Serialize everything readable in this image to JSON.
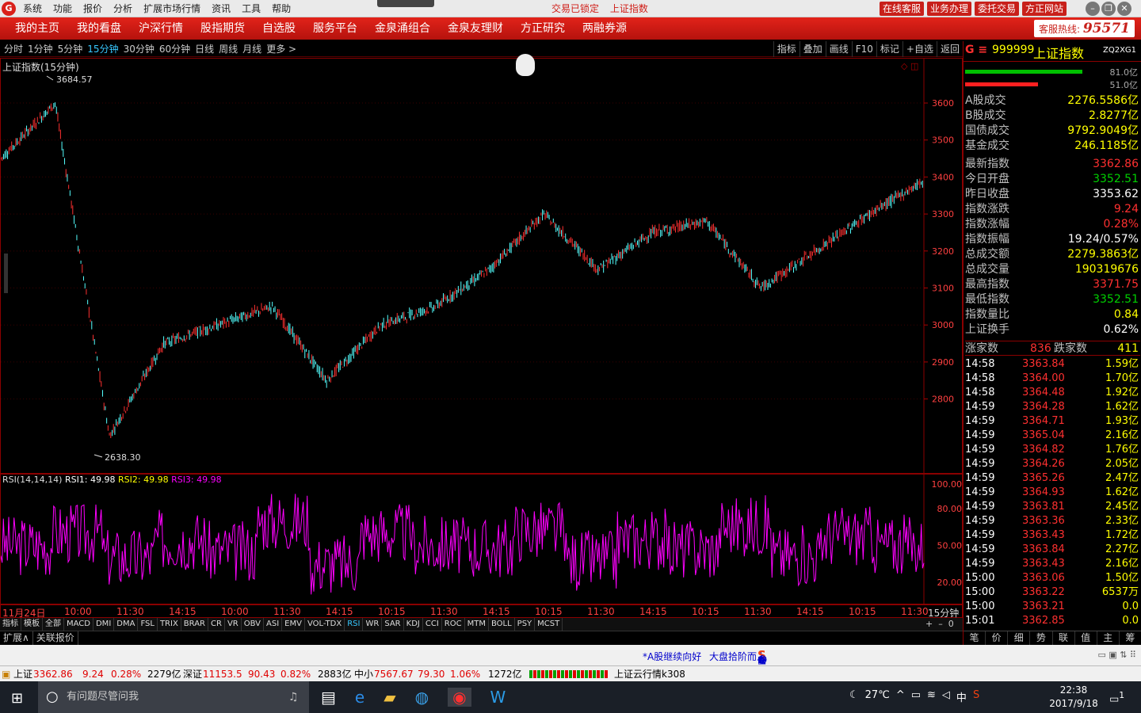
{
  "titlebar": {
    "menus": [
      "系统",
      "功能",
      "报价",
      "分析",
      "扩展市场行情",
      "资讯",
      "工具",
      "帮助"
    ],
    "status_locked": "交易已锁定",
    "current": "上证指数",
    "buttons": [
      "在线客服",
      "业务办理",
      "委托交易",
      "方正网站"
    ]
  },
  "navbar": {
    "items": [
      "我的主页",
      "我的看盘",
      "沪深行情",
      "股指期货",
      "自选股",
      "服务平台",
      "金泉涌组合",
      "金泉友理财",
      "方正研究",
      "两融券源"
    ],
    "hotline_label": "客服热线:",
    "hotline_number": "95571"
  },
  "periods": {
    "items": [
      "分时",
      "1分钟",
      "5分钟",
      "15分钟",
      "30分钟",
      "60分钟",
      "日线",
      "周线",
      "月线",
      "更多 >"
    ],
    "active": 3,
    "chart_buttons": [
      "指标",
      "叠加",
      "画线",
      "F10",
      "标记",
      "+自选",
      "返回"
    ]
  },
  "main_chart": {
    "title": "上证指数(15分钟)",
    "high_label": "3684.57",
    "low_label": "2638.30",
    "y_ticks": [
      3600,
      3500,
      3400,
      3300,
      3200,
      3100,
      3000,
      2900,
      2800
    ],
    "ylim": [
      2600,
      3720
    ]
  },
  "rsi_chart": {
    "title": "RSI(14,14,14)",
    "rsi1_label": "RSI1: 49.98",
    "rsi2_label": "RSI2: 49.98",
    "rsi3_label": "RSI3: 49.98",
    "y_ticks": [
      "100.00",
      "80.00",
      "50.00",
      "20.00"
    ]
  },
  "chart_data": {
    "type": "line",
    "title": "上证指数(15分钟)",
    "xlabel": "",
    "ylabel": "",
    "ylim": [
      2600,
      3720
    ],
    "series": [],
    "x": [
      "11月24日",
      "10:00",
      "11:30",
      "14:15",
      "10:00",
      "11:30",
      "14:15",
      "10:15",
      "11:30",
      "14:15",
      "10:15",
      "11:30",
      "14:15",
      "10:15",
      "11:30",
      "14:15",
      "10:15",
      "11:30"
    ],
    "y": [
      3450,
      3600,
      2700,
      2950,
      3000,
      3050,
      2850,
      3000,
      3050,
      3150,
      3300,
      3150,
      3250,
      3280,
      3100,
      3200,
      3300,
      3390
    ],
    "indicator_series": [
      {
        "name": "RSI",
        "values": [
          50,
          60,
          40,
          55,
          45,
          70,
          35,
          60,
          50,
          48,
          62,
          38,
          55,
          47,
          66,
          42,
          58,
          50
        ]
      }
    ],
    "annotations": [
      "3684.57",
      "2638.30"
    ]
  },
  "time_axis": {
    "labels": [
      "11月24日",
      "10:00",
      "11:30",
      "14:15",
      "10:00",
      "11:30",
      "14:15",
      "10:15",
      "11:30",
      "14:15",
      "10:15",
      "11:30",
      "14:15",
      "10:15",
      "11:30",
      "14:15",
      "10:15",
      "11:30"
    ],
    "period": "15分钟"
  },
  "indicator_tabs": {
    "items": [
      "指标",
      "模板",
      "全部",
      "MACD",
      "DMI",
      "DMA",
      "FSL",
      "TRIX",
      "BRAR",
      "CR",
      "VR",
      "OBV",
      "ASI",
      "EMV",
      "VOL-TDX",
      "RSI",
      "WR",
      "SAR",
      "KDJ",
      "CCI",
      "ROC",
      "MTM",
      "BOLL",
      "PSY",
      "MCST"
    ],
    "selected": 15
  },
  "bottom_tabs": [
    "扩展∧",
    "关联报价"
  ],
  "right_panel": {
    "code": "999999",
    "name": "上证指数",
    "tag": "ZQ2XG1",
    "bar1": "81.0亿",
    "bar2": "51.0亿",
    "turnover": [
      {
        "label": "A股成交",
        "value": "2276.5586亿"
      },
      {
        "label": "B股成交",
        "value": "2.8277亿"
      },
      {
        "label": "国债成交",
        "value": "9792.9049亿"
      },
      {
        "label": "基金成交",
        "value": "246.1185亿"
      }
    ],
    "stats": [
      {
        "label": "最新指数",
        "value": "3362.86",
        "color": "#ff3030"
      },
      {
        "label": "今日开盘",
        "value": "3352.51",
        "color": "#00d000"
      },
      {
        "label": "昨日收盘",
        "value": "3353.62",
        "color": "#ffffff"
      },
      {
        "label": "指数涨跌",
        "value": "9.24",
        "color": "#ff3030"
      },
      {
        "label": "指数涨幅",
        "value": "0.28%",
        "color": "#ff3030"
      },
      {
        "label": "指数振幅",
        "value": "19.24/0.57%",
        "color": "#ffffff"
      },
      {
        "label": "总成交额",
        "value": "2279.3863亿",
        "color": "#ffff00"
      },
      {
        "label": "总成交量",
        "value": "190319676",
        "color": "#ffff00"
      },
      {
        "label": "最高指数",
        "value": "3371.75",
        "color": "#ff3030"
      },
      {
        "label": "最低指数",
        "value": "3352.51",
        "color": "#00d000"
      },
      {
        "label": "指数量比",
        "value": "0.84",
        "color": "#ffff00"
      },
      {
        "label": "上证换手",
        "value": "0.62%",
        "color": "#ffffff"
      }
    ],
    "up_label": "涨家数",
    "up_count": "836",
    "down_label": "跌家数",
    "down_count": "411",
    "ticks": [
      {
        "t": "14:58",
        "p": "3363.84",
        "q": "1.59亿"
      },
      {
        "t": "14:58",
        "p": "3364.00",
        "q": "1.70亿"
      },
      {
        "t": "14:58",
        "p": "3364.48",
        "q": "1.92亿"
      },
      {
        "t": "14:59",
        "p": "3364.28",
        "q": "1.62亿"
      },
      {
        "t": "14:59",
        "p": "3364.71",
        "q": "1.93亿"
      },
      {
        "t": "14:59",
        "p": "3365.04",
        "q": "2.16亿"
      },
      {
        "t": "14:59",
        "p": "3364.82",
        "q": "1.76亿"
      },
      {
        "t": "14:59",
        "p": "3364.26",
        "q": "2.05亿"
      },
      {
        "t": "14:59",
        "p": "3365.26",
        "q": "2.47亿"
      },
      {
        "t": "14:59",
        "p": "3364.93",
        "q": "1.62亿"
      },
      {
        "t": "14:59",
        "p": "3363.81",
        "q": "2.45亿"
      },
      {
        "t": "14:59",
        "p": "3363.36",
        "q": "2.33亿"
      },
      {
        "t": "14:59",
        "p": "3363.43",
        "q": "1.72亿"
      },
      {
        "t": "14:59",
        "p": "3363.84",
        "q": "2.27亿"
      },
      {
        "t": "14:59",
        "p": "3363.43",
        "q": "2.16亿"
      },
      {
        "t": "15:00",
        "p": "3363.06",
        "q": "1.50亿"
      },
      {
        "t": "15:00",
        "p": "3363.22",
        "q": "6537万"
      },
      {
        "t": "15:00",
        "p": "3363.21",
        "q": "0.0"
      },
      {
        "t": "15:01",
        "p": "3362.85",
        "q": "0.0"
      }
    ],
    "tabs": [
      "笔",
      "价",
      "细",
      "势",
      "联",
      "值",
      "主",
      "筹"
    ]
  },
  "news": {
    "item1": "*A股继续向好",
    "item2": "大盘拾阶而上"
  },
  "status": {
    "sh_label": "上证",
    "sh_value": "3362.86",
    "sh_change": "9.24",
    "sh_pct": "0.28%",
    "sh_amount": "2279亿",
    "sz_label": "深证",
    "sz_value": "11153.5",
    "sz_change": "90.43",
    "sz_pct": "0.82%",
    "sz_amount": "2883亿",
    "zx_label": "中小",
    "zx_value": "7567.67",
    "zx_change": "79.30",
    "zx_pct": "1.06%",
    "zx_amount": "1272亿",
    "cloud": "上证云行情k308"
  },
  "taskbar": {
    "search_placeholder": "有问题尽管问我",
    "temp": "27℃",
    "ime": "中",
    "time": "22:38",
    "date": "2017/9/18",
    "notify": "1"
  }
}
